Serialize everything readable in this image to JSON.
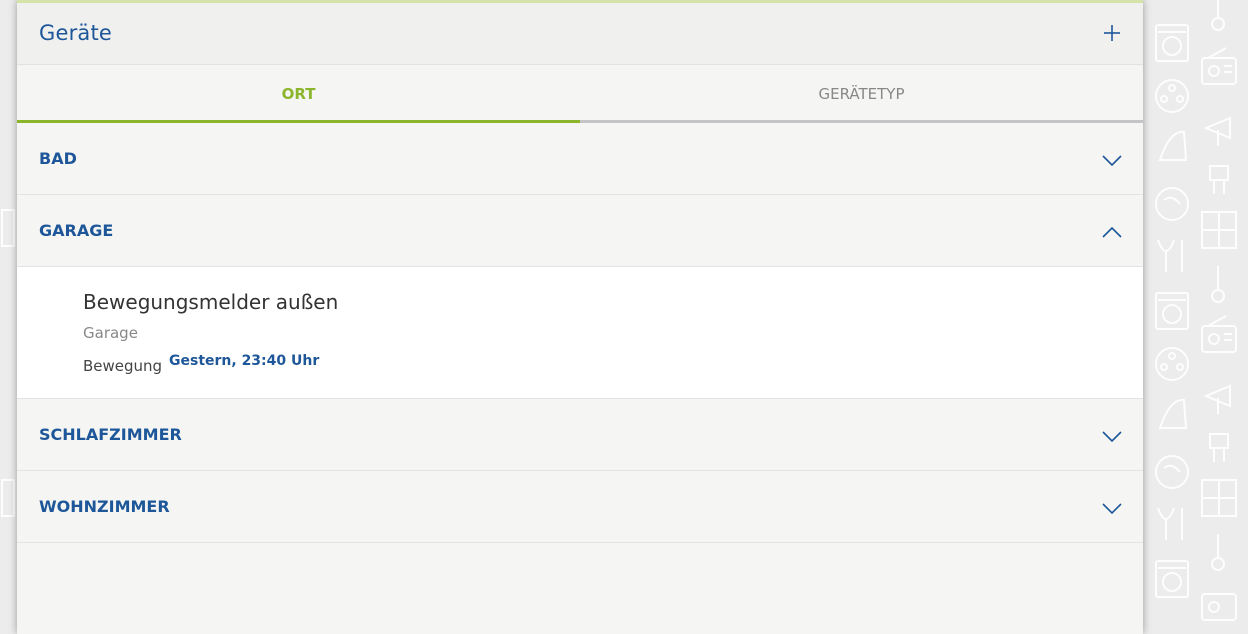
{
  "header": {
    "title": "Geräte",
    "add_icon": "plus-icon"
  },
  "tabs": [
    {
      "label": "ORT",
      "active": true
    },
    {
      "label": "GERÄTETYP",
      "active": false
    }
  ],
  "sections": [
    {
      "label": "BAD",
      "expanded": false,
      "icon": "chevron-down-icon"
    },
    {
      "label": "GARAGE",
      "expanded": true,
      "icon": "chevron-up-icon"
    },
    {
      "label": "SCHLAFZIMMER",
      "expanded": false,
      "icon": "chevron-down-icon"
    },
    {
      "label": "WOHNZIMMER",
      "expanded": false,
      "icon": "chevron-down-icon"
    }
  ],
  "garage_devices": [
    {
      "name": "Bewegungsmelder außen",
      "room": "Garage",
      "state_label": "Bewegung",
      "state_value": "Gestern, 23:40 Uhr"
    }
  ],
  "colors": {
    "primary_blue": "#1e5799",
    "accent_green": "#8bb52a",
    "panel_bg": "#f5f5f3",
    "muted_gray": "#888888"
  }
}
